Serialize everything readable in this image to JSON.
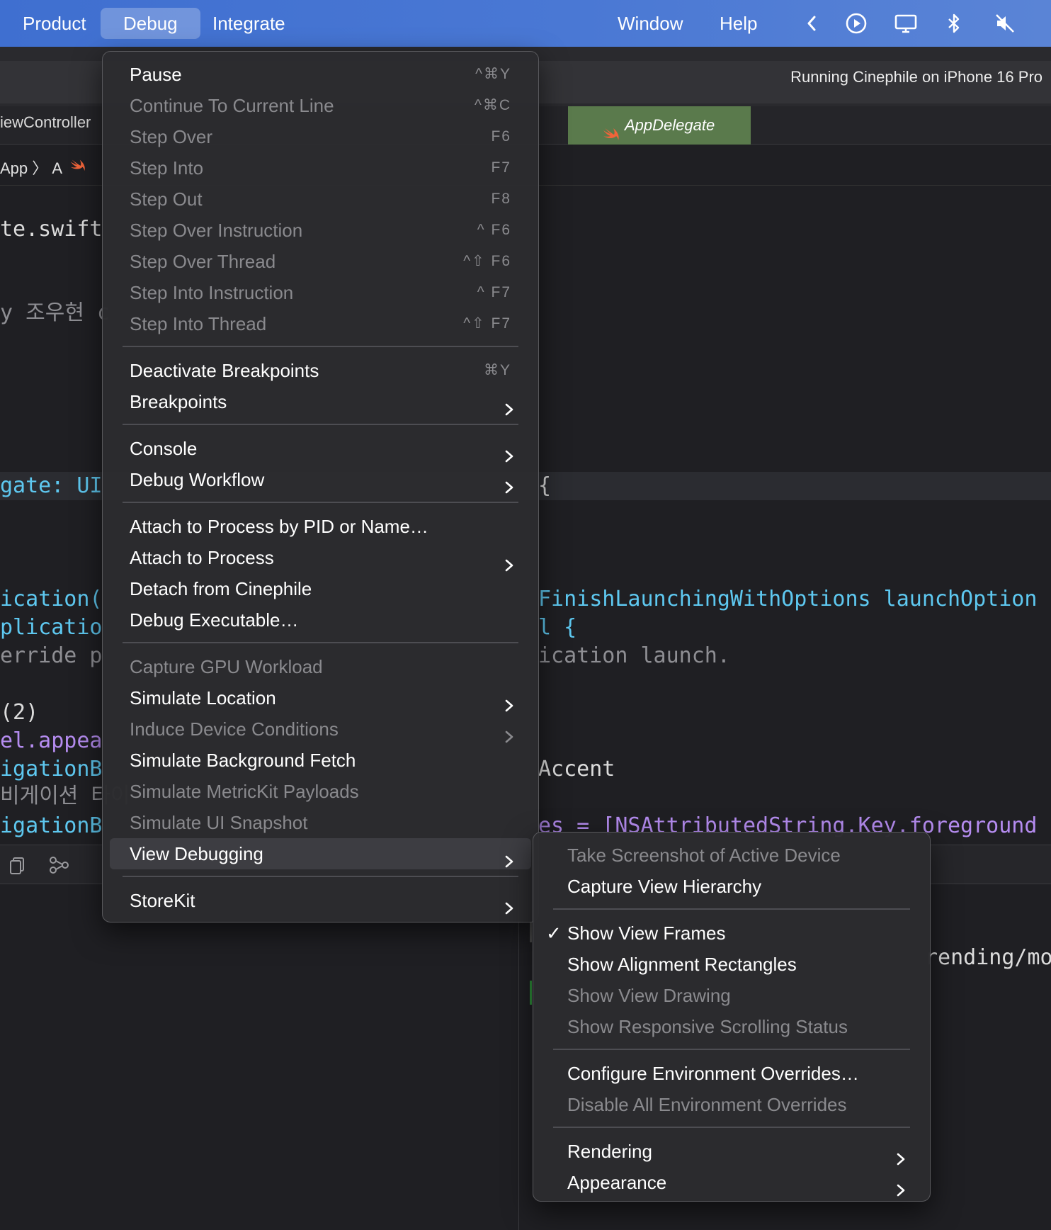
{
  "menubar": {
    "items": [
      "Product",
      "Debug",
      "Integrate",
      "Window",
      "Help"
    ],
    "active": "Debug"
  },
  "toolbar": {
    "status": "Running Cinephile on iPhone 16 Pro"
  },
  "tabs": {
    "left_partial": "iewController",
    "active": "AppDelegate"
  },
  "jumpbar": {
    "text": "App  〉       A"
  },
  "code_left": [
    {
      "text": "te.swift",
      "cls": "c-white"
    },
    {
      "text": "y 조우현 c",
      "cls": "c-gray"
    },
    {
      "text": "gate: UI",
      "cls": "c-cyan"
    },
    {
      "text": "ication(",
      "cls": "c-cyan"
    },
    {
      "text": "plicatio",
      "cls": "c-cyan"
    },
    {
      "text": "erride p",
      "cls": "c-gray"
    },
    {
      "text": "(2)",
      "cls": "c-white"
    },
    {
      "text": "el.appea",
      "cls": "c-purple"
    },
    {
      "text": "igationB",
      "cls": "c-cyan"
    },
    {
      "text": "비게이션 타이",
      "cls": "c-gray"
    },
    {
      "text": "igationB",
      "cls": "c-cyan"
    }
  ],
  "code_right": [
    {
      "text": "{",
      "cls": "c-white"
    },
    {
      "text": "FinishLaunchingWithOptions launchOption",
      "cls": "c-cyan"
    },
    {
      "text": "l {",
      "cls": "c-cyan"
    },
    {
      "text": "ication launch.",
      "cls": "c-gray"
    },
    {
      "text": "Accent",
      "cls": "c-white"
    },
    {
      "text": "es = [NSAttributedString.Key.foreground",
      "cls": "c-purple"
    },
    {
      "text": "rending/mo",
      "cls": "c-white"
    }
  ],
  "debug_menu": {
    "items": [
      {
        "label": "Pause",
        "shortcut": "^⌘Y",
        "disabled": false
      },
      {
        "label": "Continue To Current Line",
        "shortcut": "^⌘C",
        "disabled": true
      },
      {
        "label": "Step Over",
        "shortcut": "F6",
        "disabled": true
      },
      {
        "label": "Step Into",
        "shortcut": "F7",
        "disabled": true
      },
      {
        "label": "Step Out",
        "shortcut": "F8",
        "disabled": true
      },
      {
        "label": "Step Over Instruction",
        "shortcut": "^ F6",
        "disabled": true
      },
      {
        "label": "Step Over Thread",
        "shortcut": "^⇧ F6",
        "disabled": true
      },
      {
        "label": "Step Into Instruction",
        "shortcut": "^ F7",
        "disabled": true
      },
      {
        "label": "Step Into Thread",
        "shortcut": "^⇧ F7",
        "disabled": true
      },
      {
        "label": "Deactivate Breakpoints",
        "shortcut": "⌘Y",
        "disabled": false
      },
      {
        "label": "Breakpoints",
        "submenu": true,
        "disabled": false
      },
      {
        "label": "Console",
        "submenu": true,
        "disabled": false
      },
      {
        "label": "Debug Workflow",
        "submenu": true,
        "disabled": false
      },
      {
        "label": "Attach to Process by PID or Name…",
        "disabled": false
      },
      {
        "label": "Attach to Process",
        "submenu": true,
        "disabled": false
      },
      {
        "label": "Detach from Cinephile",
        "disabled": false
      },
      {
        "label": "Debug Executable…",
        "disabled": false
      },
      {
        "label": "Capture GPU Workload",
        "disabled": true
      },
      {
        "label": "Simulate Location",
        "submenu": true,
        "disabled": false
      },
      {
        "label": "Induce Device Conditions",
        "submenu": true,
        "disabled": true
      },
      {
        "label": "Simulate Background Fetch",
        "disabled": false
      },
      {
        "label": "Simulate MetricKit Payloads",
        "disabled": true
      },
      {
        "label": "Simulate UI Snapshot",
        "disabled": true
      },
      {
        "label": "View Debugging",
        "submenu": true,
        "disabled": false,
        "highlighted": true
      },
      {
        "label": "StoreKit",
        "submenu": true,
        "disabled": false
      }
    ]
  },
  "view_debugging_menu": {
    "items": [
      {
        "label": "Take Screenshot of Active Device",
        "disabled": true
      },
      {
        "label": "Capture View Hierarchy",
        "disabled": false
      },
      {
        "label": "Show View Frames",
        "disabled": false,
        "checked": true
      },
      {
        "label": "Show Alignment Rectangles",
        "disabled": false
      },
      {
        "label": "Show View Drawing",
        "disabled": true
      },
      {
        "label": "Show Responsive Scrolling Status",
        "disabled": true
      },
      {
        "label": "Configure Environment Overrides…",
        "disabled": false
      },
      {
        "label": "Disable All Environment Overrides",
        "disabled": true
      },
      {
        "label": "Rendering",
        "submenu": true,
        "disabled": false
      },
      {
        "label": "Appearance",
        "submenu": true,
        "disabled": false
      }
    ],
    "checkmark": "✓"
  }
}
